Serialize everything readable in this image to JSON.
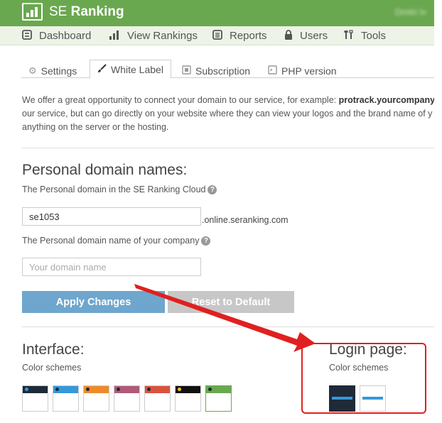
{
  "header": {
    "brand_prefix": "SE",
    "brand_name": "Ranking",
    "user_name": "Dmitri Iv"
  },
  "nav": {
    "items": [
      {
        "label": "Dashboard",
        "icon": "dashboard-icon"
      },
      {
        "label": "View Rankings",
        "icon": "bar-chart-icon"
      },
      {
        "label": "Reports",
        "icon": "reports-icon"
      },
      {
        "label": "Users",
        "icon": "lock-icon"
      },
      {
        "label": "Tools",
        "icon": "tools-icon"
      }
    ]
  },
  "tabs": [
    {
      "label": "Settings",
      "icon": "gears-icon",
      "active": false
    },
    {
      "label": "White Label",
      "icon": "brush-icon",
      "active": true
    },
    {
      "label": "Subscription",
      "icon": "subscription-icon",
      "active": false
    },
    {
      "label": "PHP version",
      "icon": "php-icon",
      "active": false
    }
  ],
  "intro": {
    "line1_prefix": "We offer a great opportunity to connect your domain to our service, for example: ",
    "line1_bold": "protrack.yourcompany.",
    "line2": "our service, but can go directly on your website where they can view your logos and the brand name of y",
    "line3": "anything on the server or the hosting."
  },
  "personal_domain": {
    "title": "Personal domain names:",
    "cloud_label": "The Personal domain in the SE Ranking Cloud",
    "cloud_value": "se1053",
    "cloud_suffix": ".online.seranking.com",
    "company_label": "The Personal domain name of your company",
    "company_placeholder": "Your domain name",
    "help_glyph": "?"
  },
  "buttons": {
    "apply": "Apply Changes",
    "reset": "Reset to Default"
  },
  "interface": {
    "title": "Interface:",
    "schemes_label": "Color schemes",
    "schemes": [
      {
        "band": "#1e2a38",
        "dot": "#3498db"
      },
      {
        "band": "#3498db",
        "dot": "#1e2a38"
      },
      {
        "band": "#ee8a2b",
        "dot": "#1e2a38"
      },
      {
        "band": "#b05a78",
        "dot": "#1e2a38"
      },
      {
        "band": "#d9533c",
        "dot": "#1e2a38"
      },
      {
        "band": "#111111",
        "dot": "#f0c419"
      },
      {
        "band": "#6aa84f",
        "dot": "#1e2a38",
        "selected": true
      }
    ]
  },
  "login_page": {
    "title": "Login page:",
    "schemes_label": "Color schemes",
    "schemes": [
      {
        "bg": "#1e2a38",
        "selected": true
      },
      {
        "bg": "#ffffff",
        "selected": false
      }
    ]
  },
  "colors": {
    "brand_green": "#6aa84f",
    "apply_blue": "#6ea6cd",
    "annotation_red": "#e02020"
  }
}
